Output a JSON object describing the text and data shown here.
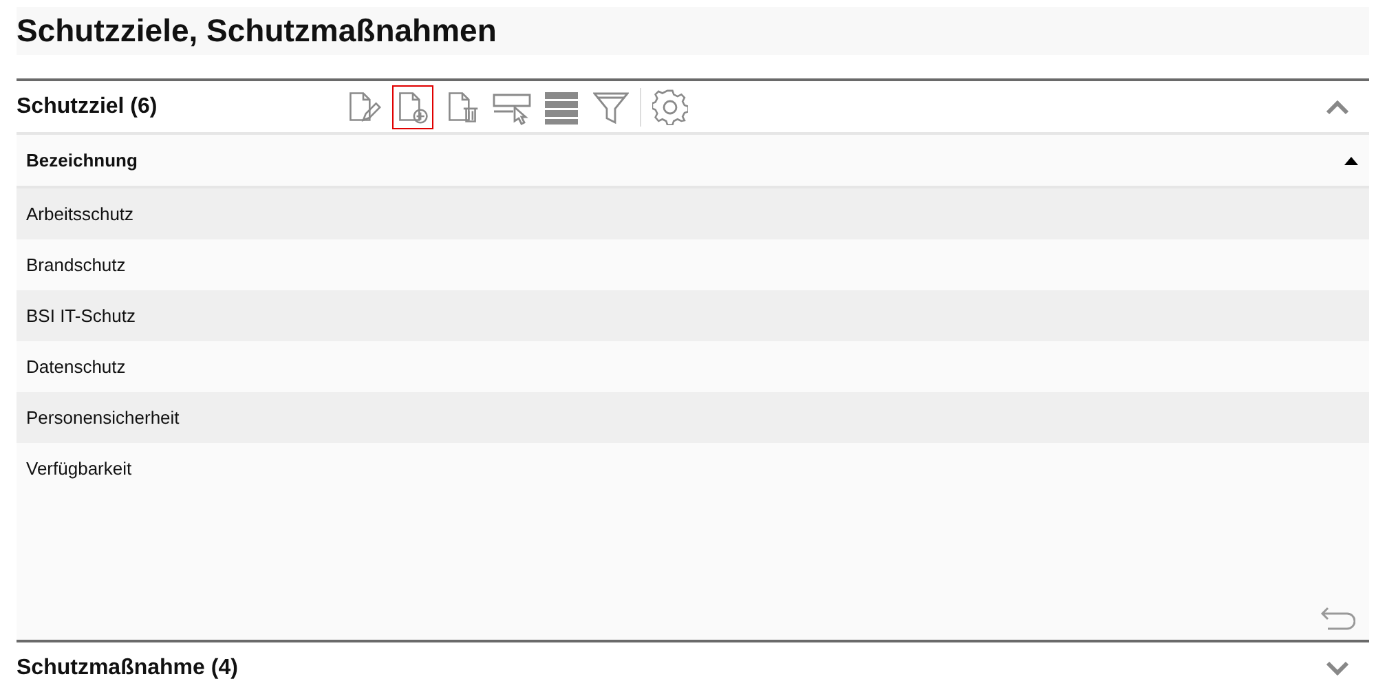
{
  "page": {
    "title": "Schutzziele, Schutzmaßnahmen"
  },
  "sections": [
    {
      "title": "Schutzziel (6)",
      "expanded": true,
      "toolbar": [
        {
          "kind": "edit",
          "focused": false
        },
        {
          "kind": "add",
          "focused": true
        },
        {
          "kind": "delete",
          "focused": false
        },
        {
          "kind": "select",
          "focused": false
        },
        {
          "kind": "rows",
          "focused": false
        },
        {
          "kind": "filter",
          "focused": false
        },
        {
          "kind": "separator"
        },
        {
          "kind": "settings",
          "focused": false
        }
      ],
      "table": {
        "columns": [
          {
            "label": "Bezeichnung",
            "sorted_ascending": true
          }
        ],
        "rows": [
          [
            "Arbeitsschutz"
          ],
          [
            "Brandschutz"
          ],
          [
            "BSI IT-Schutz"
          ],
          [
            "Datenschutz"
          ],
          [
            "Personensicherheit"
          ],
          [
            "Verfügbarkeit"
          ]
        ]
      }
    },
    {
      "title": "Schutzmaßnahme (4)",
      "expanded": false
    }
  ]
}
